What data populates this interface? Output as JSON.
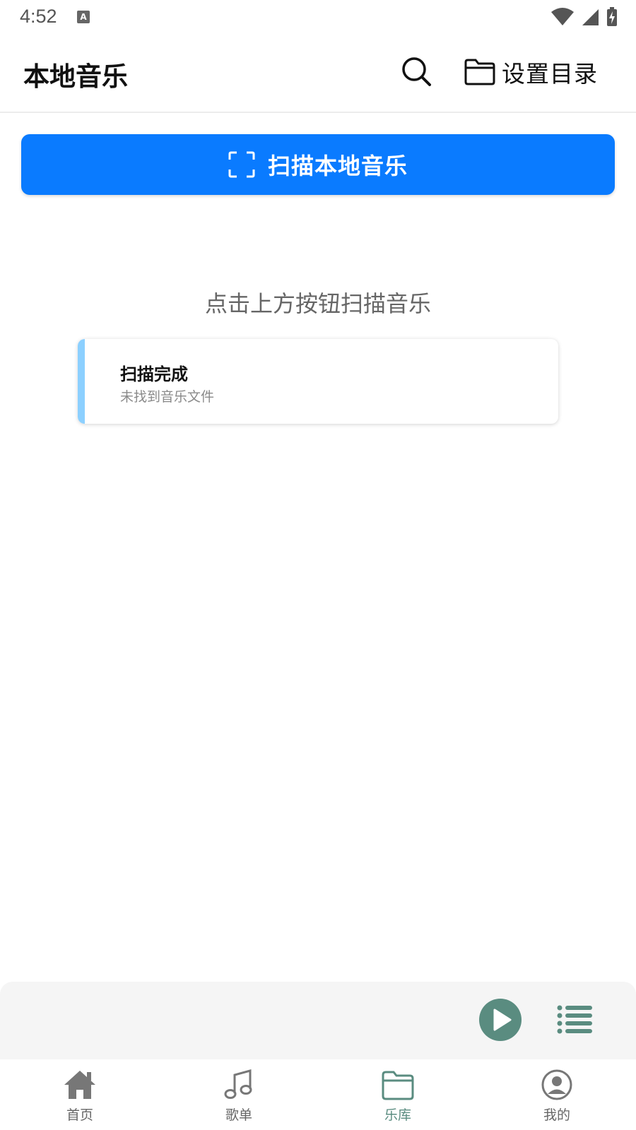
{
  "status_bar": {
    "time": "4:52"
  },
  "app_bar": {
    "title": "本地音乐",
    "set_directory_label": "设置目录"
  },
  "scan_button": {
    "label": "扫描本地音乐"
  },
  "hint": "点击上方按钮扫描音乐",
  "toast": {
    "title": "扫描完成",
    "message": "未找到音乐文件",
    "accent_color": "#8cd0ff"
  },
  "mini_player": {
    "play_icon": "play-icon",
    "queue_icon": "playlist-queue-icon"
  },
  "bottom_nav": {
    "items": [
      {
        "label": "首页",
        "icon": "home-icon",
        "active": false
      },
      {
        "label": "歌单",
        "icon": "music-note-icon",
        "active": false
      },
      {
        "label": "乐库",
        "icon": "folder-icon",
        "active": true
      },
      {
        "label": "我的",
        "icon": "profile-icon",
        "active": false
      }
    ]
  },
  "colors": {
    "primary": "#0a7bff",
    "accent": "#5a8c80",
    "inactive": "#666666"
  }
}
